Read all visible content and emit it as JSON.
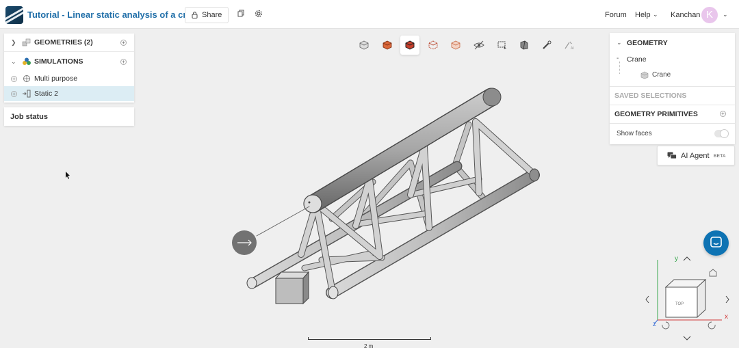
{
  "header": {
    "title": "Tutorial - Linear static analysis of a crane",
    "share_label": "Share",
    "forum_label": "Forum",
    "help_label": "Help",
    "user_name": "Kanchan",
    "avatar_initial": "K"
  },
  "tree": {
    "geometries_label": "GEOMETRIES (2)",
    "simulations_label": "SIMULATIONS",
    "items": [
      {
        "label": "Multi purpose",
        "selected": false
      },
      {
        "label": "Static 2",
        "selected": true
      }
    ]
  },
  "job_status": {
    "label": "Job status"
  },
  "toolbar": {
    "tools": [
      "view-cube-icon",
      "solid-view-icon",
      "solid-edges-view-icon",
      "wireframe-view-icon",
      "transparent-view-icon",
      "hide-icon",
      "box-select-icon",
      "section-icon",
      "measure-icon",
      "ai-tools-icon"
    ],
    "active_index": 2
  },
  "geometry_panel": {
    "heading": "GEOMETRY",
    "root_label": "Crane",
    "child_label": "Crane",
    "saved_selections_label": "SAVED SELECTIONS",
    "primitives_label": "GEOMETRY PRIMITIVES",
    "show_faces_label": "Show faces",
    "show_faces_on": false
  },
  "ai_agent": {
    "label": "AI Agent",
    "badge": "BETA"
  },
  "orientation": {
    "top_face": "TOP",
    "x_label": "x",
    "y_label": "y",
    "z_label": "z"
  },
  "scale": {
    "label": "2 m"
  },
  "colors": {
    "accent": "#1f6ea8",
    "chat": "#0e73b3",
    "avatar": "#e9c6ec",
    "selected_row": "#dcedf4"
  }
}
